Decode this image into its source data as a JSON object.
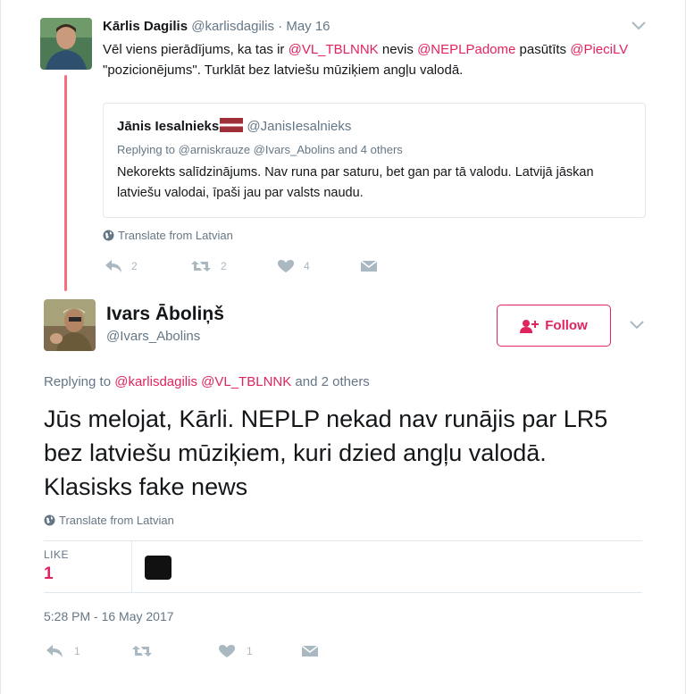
{
  "tweet1": {
    "author_name": "Kārlis Dagilis",
    "author_handle": "@karlisdagilis",
    "separator": "·",
    "date": "May 16",
    "text_segments": [
      {
        "text": "Vēl viens pierādījums, ka tas ir ",
        "mention": false
      },
      {
        "text": "@VL_TBLNNK",
        "mention": true
      },
      {
        "text": " nevis ",
        "mention": false
      },
      {
        "text": "@NEPLPadome",
        "mention": true
      },
      {
        "text": " pasūtīts ",
        "mention": false
      },
      {
        "text": "@PieciLV",
        "mention": true
      },
      {
        "text": " \"pozicionējums\". Turklāt bez latviešu mūziķiem angļu valodā.",
        "mention": false
      }
    ],
    "quote": {
      "author_name": "Jānis Iesalnieks",
      "author_handle": "@JanisIesalnieks",
      "replying_to": "Replying to @arniskrauze @Ivars_Abolins and 4 others",
      "text": "Nekorekts salīdzinājums. Nav runa par saturu, bet gan par tā valodu. Latvijā jāskan latviešu valodai, īpaši jau par valsts naudu."
    },
    "translate_label": "Translate from Latvian",
    "reply_count": "2",
    "retweet_count": "2",
    "like_count": "4"
  },
  "tweet2": {
    "author_name": "Ivars Āboliņš",
    "author_handle": "@Ivars_Abolins",
    "follow_label": "Follow",
    "replying_prefix": "Replying to ",
    "replying_mentions": "@karlisdagilis @VL_TBLNNK",
    "replying_suffix": " and 2 others",
    "text": "Jūs melojat, Kārli. NEPLP nekad nav runājis par LR5 bez latviešu mūziķiem, kuri dzied angļu valodā. Klasisks fake news",
    "translate_label": "Translate from Latvian",
    "likes_label": "LIKE",
    "likes_count": "1",
    "timestamp": "5:28 PM - 16 May 2017",
    "reply_count": "1",
    "like_count": "1"
  },
  "colors": {
    "accent": "#e0245e",
    "thread_line": "#f5707d",
    "secondary_text": "#657786",
    "icon_gray": "#aab8c2"
  },
  "icons": {
    "reply": "reply-icon",
    "retweet": "retweet-icon",
    "like": "heart-icon",
    "dm": "envelope-icon",
    "globe": "globe-icon",
    "chevron": "chevron-down-icon",
    "follow": "add-user-icon"
  }
}
